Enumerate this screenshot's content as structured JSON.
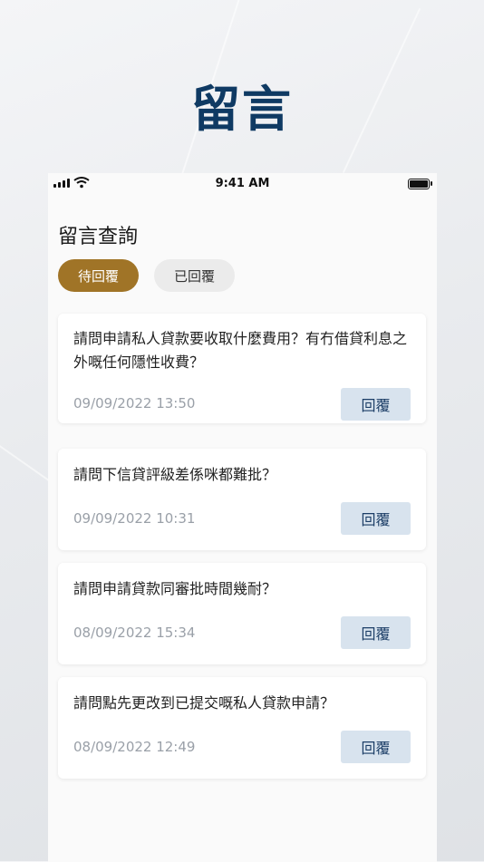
{
  "promo": {
    "title": "留言"
  },
  "status_bar": {
    "time": "9:41 AM"
  },
  "page": {
    "title": "留言查詢"
  },
  "tabs": [
    {
      "label": "待回覆",
      "active": true
    },
    {
      "label": "已回覆",
      "active": false
    }
  ],
  "messages": [
    {
      "question": "請問申請私人貸款要收取什麼費用？有冇借貸利息之外嘅任何隱性收費？",
      "datetime": "09/09/2022 13:50",
      "reply_label": "回覆"
    },
    {
      "question": "請問下信貸評級差係咪都難批？",
      "datetime": "09/09/2022 10:31",
      "reply_label": "回覆"
    },
    {
      "question": "請問申請貸款同審批時間幾耐？",
      "datetime": "08/09/2022 15:34",
      "reply_label": "回覆"
    },
    {
      "question": "請問點先更改到已提交嘅私人貸款申請？",
      "datetime": "08/09/2022 12:49",
      "reply_label": "回覆"
    }
  ],
  "colors": {
    "accent_gold": "#a07427",
    "brand_navy": "#0f3a63",
    "reply_button_bg": "#d8e3ee"
  }
}
